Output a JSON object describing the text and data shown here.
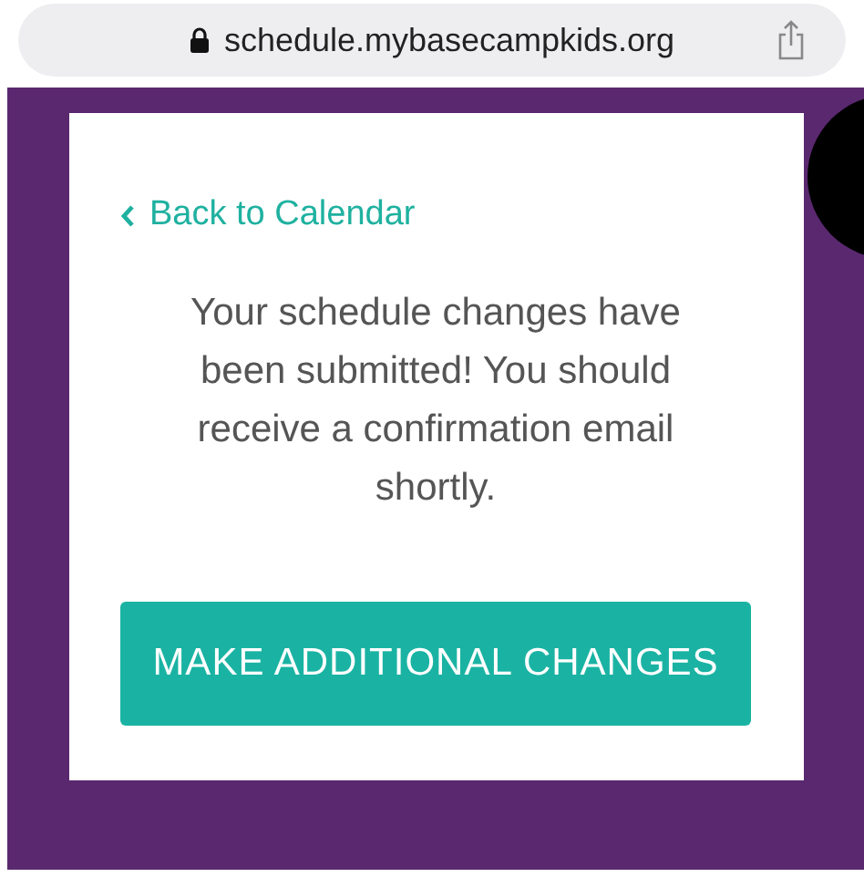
{
  "address_bar": {
    "url": "schedule.mybasecampkids.org"
  },
  "card": {
    "back_link": "Back to Calendar",
    "message": "Your schedule changes have been submitted! You should receive a confirmation email shortly.",
    "button": "MAKE ADDITIONAL CHANGES"
  }
}
